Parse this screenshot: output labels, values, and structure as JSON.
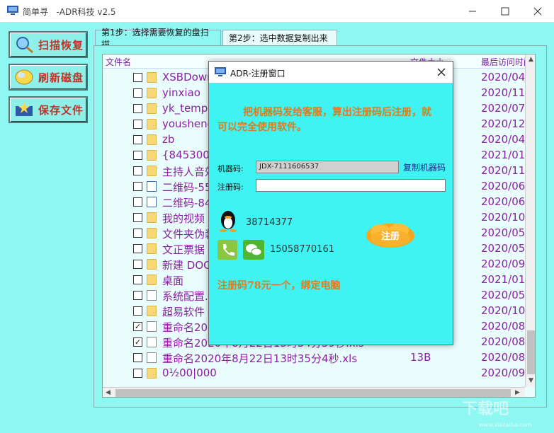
{
  "window": {
    "title": "简单寻   -ADR科技 v2.5"
  },
  "sidebar": {
    "items": [
      {
        "label": "扫描恢复"
      },
      {
        "label": "刷新磁盘"
      },
      {
        "label": "保存文件"
      }
    ]
  },
  "tabs": [
    {
      "label": "第1步：选择需要恢复的盘扫描"
    },
    {
      "label": "第2步：选中数据复制出来"
    }
  ],
  "table": {
    "columns": [
      "文件名",
      "文件大小",
      "最后访问时间"
    ],
    "rows": [
      {
        "checked": false,
        "icon": "folder",
        "name": "XSBDownload",
        "size": "",
        "date": "2020/04"
      },
      {
        "checked": false,
        "icon": "folder",
        "name": "yinxiao",
        "size": "",
        "date": "2020/11"
      },
      {
        "checked": false,
        "icon": "folder",
        "name": "yk_temp",
        "size": "",
        "date": "2020/07"
      },
      {
        "checked": false,
        "icon": "folder",
        "name": "youshengxiaoshuo",
        "size": "",
        "date": "2020/12"
      },
      {
        "checked": false,
        "icon": "folder",
        "name": "zb",
        "size": "",
        "date": "2020/04"
      },
      {
        "checked": false,
        "icon": "folder",
        "name": "{84530083",
        "size": "",
        "date": "2021/01"
      },
      {
        "checked": false,
        "icon": "folder",
        "name": "主持人音效",
        "size": "",
        "date": "2020/11"
      },
      {
        "checked": false,
        "icon": "image",
        "name": "二维码-55",
        "size": "B",
        "date": "2020/06"
      },
      {
        "checked": false,
        "icon": "image",
        "name": "二维码-84",
        "size": "B",
        "date": "2020/06"
      },
      {
        "checked": false,
        "icon": "folder",
        "name": "我的视频",
        "size": "",
        "date": "2020/10"
      },
      {
        "checked": false,
        "icon": "folder",
        "name": "文件夹伪装",
        "size": "",
        "date": "2020/05"
      },
      {
        "checked": false,
        "icon": "folder",
        "name": "文正票据",
        "size": "",
        "date": "2020/05"
      },
      {
        "checked": false,
        "icon": "folder",
        "name": "新建 DOC",
        "size": "",
        "date": "2020/09"
      },
      {
        "checked": false,
        "icon": "folder",
        "name": "桌面",
        "size": "",
        "date": "2021/01"
      },
      {
        "checked": false,
        "icon": "config",
        "name": "系统配置.ini",
        "size": "",
        "date": "2020/05"
      },
      {
        "checked": false,
        "icon": "folder",
        "name": "超易软件",
        "size": "",
        "date": "2020/10"
      },
      {
        "checked": true,
        "icon": "doc",
        "name": "重命名2020",
        "size": "",
        "date": "2020/08"
      },
      {
        "checked": true,
        "icon": "doc",
        "name": "重命名2020年8月22日13时34分59秒.xls",
        "size": "13B",
        "date": "2020/08"
      },
      {
        "checked": false,
        "icon": "doc",
        "name": "重命名2020年8月22日13时35分4秒.xls",
        "size": "13B",
        "date": "2020/08"
      },
      {
        "checked": false,
        "icon": "folder",
        "name": "0½00|000",
        "size": "",
        "date": "2020/09"
      }
    ]
  },
  "dialog": {
    "title": "ADR-注册窗口",
    "notice": "把机器码发给客服，算出注册码后注册，就可以完全使用软件。",
    "machine_label": "机器码:",
    "machine_value": "JDX-7111606537",
    "copy_label": "复制机器码",
    "reg_label": "注册码:",
    "reg_value": "",
    "qq": "38714377",
    "phone": "15058770161",
    "register_button": "注册",
    "price_text": "注册码78元一个，绑定电脑"
  },
  "watermark": {
    "text": "下载吧",
    "url": "www.xiazaiba.com"
  },
  "colors": {
    "app_bg": "#8ff7f1",
    "dialog_bg": "#3ff3f3",
    "row_text": "#8b1fa5",
    "accent_text": "#e07a1a",
    "button_text": "#c0322a"
  }
}
